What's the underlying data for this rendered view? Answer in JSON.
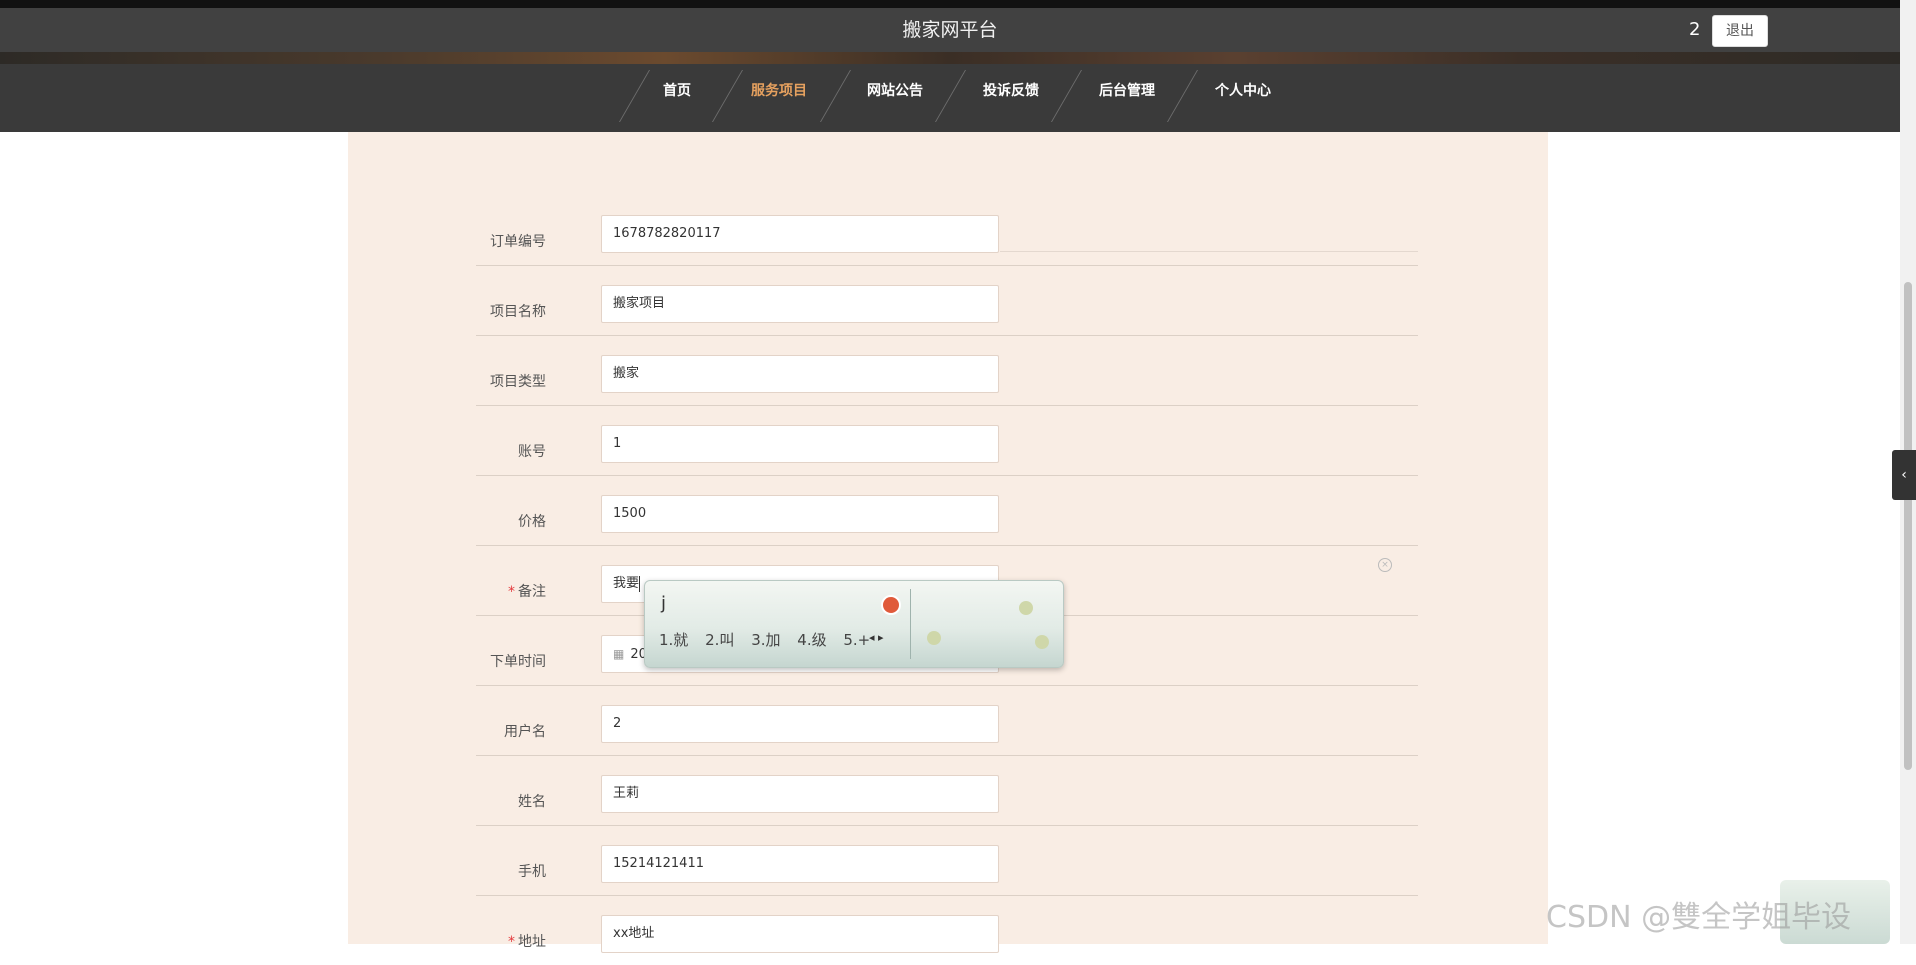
{
  "header": {
    "title": "搬家网平台",
    "username": "2",
    "logout_label": "退出"
  },
  "nav": {
    "items": [
      {
        "label": "首页"
      },
      {
        "label": "服务项目",
        "active": true
      },
      {
        "label": "网站公告"
      },
      {
        "label": "投诉反馈"
      },
      {
        "label": "后台管理"
      },
      {
        "label": "个人中心"
      }
    ]
  },
  "form": {
    "fields": [
      {
        "label": "订单编号",
        "value": "1678782820117"
      },
      {
        "label": "项目名称",
        "value": "搬家项目"
      },
      {
        "label": "项目类型",
        "value": "搬家"
      },
      {
        "label": "账号",
        "value": "1"
      },
      {
        "label": "价格",
        "value": "1500"
      },
      {
        "label": "备注",
        "value": "我要",
        "required": "*"
      },
      {
        "label": "下单时间",
        "value": "20"
      },
      {
        "label": "用户名",
        "value": "2"
      },
      {
        "label": "姓名",
        "value": "王莉"
      },
      {
        "label": "手机",
        "value": "15214121411"
      },
      {
        "label": "地址",
        "value": "xx地址",
        "required": "*"
      }
    ]
  },
  "ime": {
    "pinyin": "j",
    "candidates": [
      "1.就",
      "2.叫",
      "3.加",
      "4.级",
      "5.+"
    ],
    "arrows": "◂ ▸"
  },
  "side": {
    "toggle_glyph": "‹"
  },
  "watermark": "CSDN @雙全学姐毕设"
}
